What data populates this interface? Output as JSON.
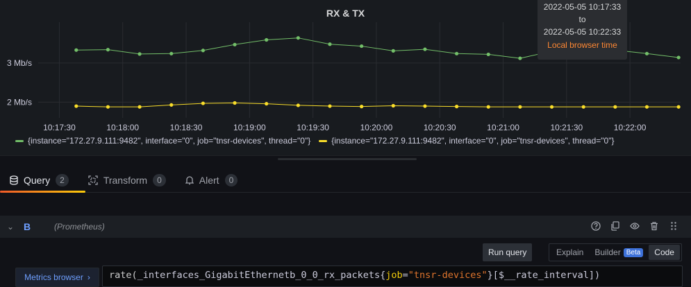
{
  "panel": {
    "title": "RX & TX"
  },
  "tooltip": {
    "from": "2022-05-05 10:17:33",
    "to_word": "to",
    "to": "2022-05-05 10:22:33",
    "timezone": "Local browser time"
  },
  "chart_data": {
    "type": "line",
    "x": [
      "10:17:20",
      "10:17:35",
      "10:17:50",
      "10:18:05",
      "10:18:20",
      "10:18:35",
      "10:18:50",
      "10:19:05",
      "10:19:20",
      "10:19:35",
      "10:19:50",
      "10:20:05",
      "10:20:20",
      "10:20:35",
      "10:20:50",
      "10:21:05",
      "10:21:20",
      "10:21:35",
      "10:21:50",
      "10:22:05",
      "10:22:20"
    ],
    "xtick_labels": [
      "10:17:30",
      "10:18:00",
      "10:18:30",
      "10:19:00",
      "10:19:30",
      "10:20:00",
      "10:20:30",
      "10:21:00",
      "10:21:30",
      "10:22:00"
    ],
    "ytick_labels": [
      "3 Mb/s",
      "2 Mb/s"
    ],
    "yticks": [
      3,
      2
    ],
    "ylim": [
      1.6,
      3.9
    ],
    "grid": true,
    "legend_placement": "bottom-left",
    "series": [
      {
        "name": "{instance=\"172.27.9.111:9482\", interface=\"0\", job=\"tnsr-devices\", thread=\"0\"}",
        "color": "#73bf69",
        "values": [
          3.33,
          3.34,
          3.23,
          3.24,
          3.32,
          3.47,
          3.59,
          3.64,
          3.48,
          3.43,
          3.31,
          3.35,
          3.24,
          3.22,
          3.12,
          3.3,
          3.28,
          3.33,
          3.24,
          3.14
        ]
      },
      {
        "name": "{instance=\"172.27.9.111:9482\", interface=\"0\", job=\"tnsr-devices\", thread=\"0\"}",
        "color": "#fade2a",
        "values": [
          1.9,
          1.88,
          1.88,
          1.93,
          1.97,
          1.98,
          1.96,
          1.92,
          1.9,
          1.89,
          1.91,
          1.9,
          1.89,
          1.88,
          1.88,
          1.88,
          1.88,
          1.88,
          1.88,
          1.88
        ]
      }
    ]
  },
  "tabs": [
    {
      "label": "Query",
      "count": "2",
      "icon": "database-icon"
    },
    {
      "label": "Transform",
      "count": "0",
      "icon": "transform-icon"
    },
    {
      "label": "Alert",
      "count": "0",
      "icon": "bell-icon"
    }
  ],
  "query": {
    "ref_id": "B",
    "datasource": "(Prometheus)",
    "run_label": "Run query",
    "modes": {
      "explain": "Explain",
      "builder": "Builder",
      "beta": "Beta",
      "code": "Code"
    },
    "metrics_browser": "Metrics browser",
    "expr": {
      "fn": "rate(",
      "metric": "_interfaces_GigabitEthernetb_0_0_rx_packets{",
      "label": "job",
      "eq": "=",
      "value": "\"tnsr-devices\"",
      "rest": "}[$__rate_interval])"
    }
  }
}
